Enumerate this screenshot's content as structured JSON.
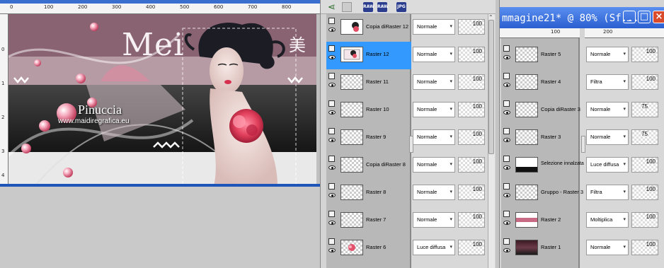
{
  "canvas": {
    "ruler_marks": [
      "0",
      "100",
      "200",
      "300",
      "400",
      "500",
      "600",
      "700",
      "800"
    ],
    "ruler_v_marks": [
      "0",
      "1",
      "2",
      "3",
      "4"
    ],
    "art_title": "Mei",
    "art_kanji": "美",
    "watermark_name": "Pinuccia",
    "watermark_site": "www.maidiregrafica.eu"
  },
  "panel1": {
    "toolbar_icons": [
      "RAW",
      "RAW",
      "JPG"
    ],
    "layers": [
      {
        "name": "Copia diRaster 12",
        "blend": "Normale",
        "opacity": "100",
        "selected": false
      },
      {
        "name": "Raster 12",
        "blend": "Normale",
        "opacity": "100",
        "selected": true
      },
      {
        "name": "Raster 11",
        "blend": "Normale",
        "opacity": "100",
        "selected": false
      },
      {
        "name": "Raster 10",
        "blend": "Normale",
        "opacity": "100",
        "selected": false
      },
      {
        "name": "Raster 9",
        "blend": "Normale",
        "opacity": "100",
        "selected": false
      },
      {
        "name": "Copia diRaster 8",
        "blend": "Normale",
        "opacity": "100",
        "selected": false
      },
      {
        "name": "Raster 8",
        "blend": "Normale",
        "opacity": "100",
        "selected": false
      },
      {
        "name": "Raster 7",
        "blend": "Normale",
        "opacity": "100",
        "selected": false
      },
      {
        "name": "Raster 6",
        "blend": "Luce diffusa",
        "opacity": "100",
        "selected": false
      }
    ]
  },
  "panel2": {
    "title": "mmagine21* @  80% (Sf...",
    "ruler_marks": [
      "100",
      "200"
    ],
    "layers": [
      {
        "name": "Raster 5",
        "blend": "Normale",
        "opacity": "100"
      },
      {
        "name": "Raster 4",
        "blend": "Filtra",
        "opacity": "100"
      },
      {
        "name": "Copia diRaster 3",
        "blend": "Normale",
        "opacity": "75"
      },
      {
        "name": "Raster 3",
        "blend": "Normale",
        "opacity": "75"
      },
      {
        "name": "Selezione innalzata",
        "blend": "Luce diffusa",
        "opacity": "100"
      },
      {
        "name": "Gruppo - Raster 3",
        "blend": "Filtra",
        "opacity": "100"
      },
      {
        "name": "Raster 2",
        "blend": "Moltiplica",
        "opacity": "100"
      },
      {
        "name": "Raster 1",
        "blend": "Normale",
        "opacity": "100"
      }
    ]
  }
}
